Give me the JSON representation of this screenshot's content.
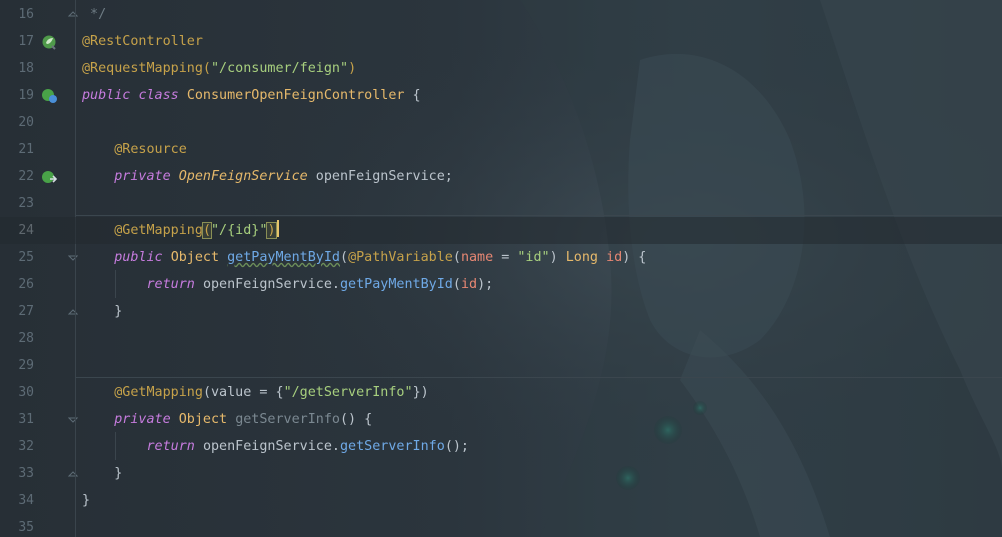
{
  "lines": [
    {
      "num": "16",
      "text": " */"
    },
    {
      "num": "17",
      "text": "@RestController"
    },
    {
      "num": "18",
      "text_a": "@RequestMapping(",
      "text_b": "\"/consumer/feign\"",
      "text_c": ")"
    },
    {
      "num": "19",
      "kw1": "public",
      "kw2": "class",
      "cls": "ConsumerOpenFeignController",
      "tail": " {"
    },
    {
      "num": "20"
    },
    {
      "num": "21",
      "ann": "@Resource"
    },
    {
      "num": "22",
      "kw": "private",
      "type": "OpenFeignService",
      "tail": " openFeignService;"
    },
    {
      "num": "23"
    },
    {
      "num": "24",
      "ann": "@GetMapping",
      "open": "(",
      "str": "\"/{id}\"",
      "close": ")"
    },
    {
      "num": "25",
      "kw": "public",
      "type": "Object",
      "fn": "getPayMentById",
      "pv": "@PathVariable",
      "name_kw": "name",
      "eq": " = ",
      "str": "\"id\"",
      "ltype": "Long",
      "param": "id",
      "tail": ") {"
    },
    {
      "num": "26",
      "kw": "return",
      "obj": "openFeignService.",
      "fn": "getPayMentById",
      "param": "id",
      "tail": ");"
    },
    {
      "num": "27",
      "text": "}"
    },
    {
      "num": "28"
    },
    {
      "num": "29"
    },
    {
      "num": "30",
      "ann": "@GetMapping",
      "pre": "(value = {",
      "str": "\"/getServerInfo\"",
      "tail": "})"
    },
    {
      "num": "31",
      "kw": "private",
      "type": "Object",
      "fn": "getServerInfo",
      "tail": "() {"
    },
    {
      "num": "32",
      "kw": "return",
      "obj": "openFeignService.",
      "fn": "getServerInfo",
      "tail": "();"
    },
    {
      "num": "33",
      "text": "}"
    },
    {
      "num": "34",
      "text": "}"
    },
    {
      "num": "35"
    }
  ],
  "gutter_icons": {
    "l17": "spring-bean-icon",
    "l19": "spring-class-icon",
    "l22": "autowire-icon"
  },
  "colors": {
    "background": "#283037",
    "annotation": "#c6a24a",
    "keyword": "#c67cde",
    "type": "#e6b96b",
    "string": "#a7cf7e",
    "method": "#6fa9e6",
    "parameter": "#e78773"
  }
}
